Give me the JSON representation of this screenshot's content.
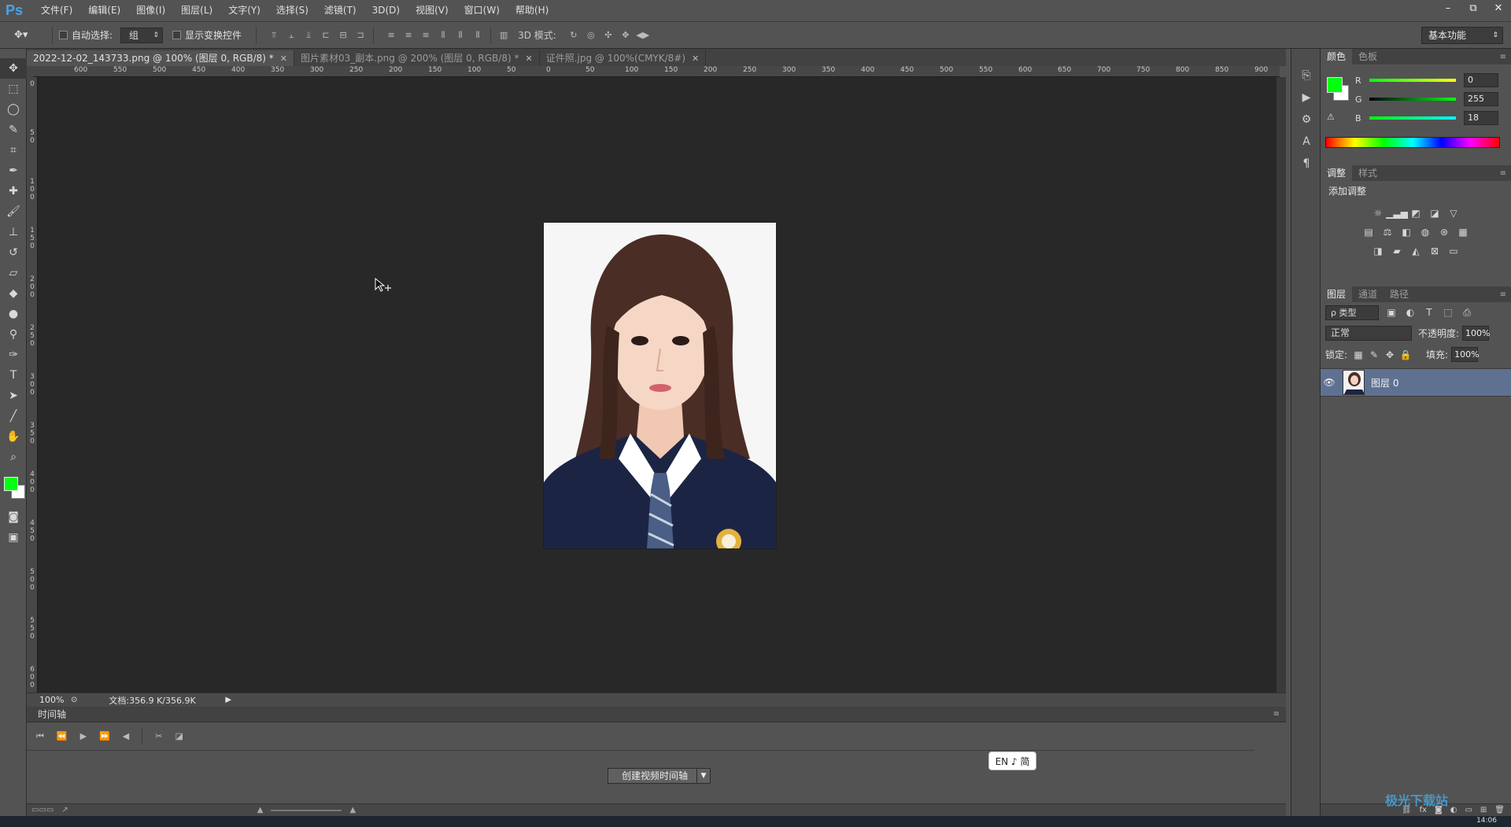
{
  "app": {
    "logo": "Ps"
  },
  "menu": [
    "文件(F)",
    "编辑(E)",
    "图像(I)",
    "图层(L)",
    "文字(Y)",
    "选择(S)",
    "滤镜(T)",
    "3D(D)",
    "视图(V)",
    "窗口(W)",
    "帮助(H)"
  ],
  "window_controls": {
    "minimize": "–",
    "restore": "⧉",
    "close": "✕"
  },
  "options": {
    "auto_select_label": "自动选择:",
    "auto_select_value": "组",
    "show_transform_label": "显示变换控件",
    "mode_3d_label": "3D 模式:",
    "workspace": "基本功能"
  },
  "tabs": [
    {
      "label": "2022-12-02_143733.png @ 100% (图层 0, RGB/8) *",
      "active": true
    },
    {
      "label": "图片素材03_副本.png @ 200% (图层 0, RGB/8) *",
      "active": false
    },
    {
      "label": "证件照.jpg @ 100%(CMYK/8#)",
      "active": false
    }
  ],
  "ruler_h_labels": [
    "600",
    "550",
    "500",
    "450",
    "400",
    "350",
    "300",
    "250",
    "200",
    "150",
    "100",
    "50",
    "0",
    "50",
    "100",
    "150",
    "200",
    "250",
    "300",
    "350",
    "400",
    "450",
    "500",
    "550",
    "600",
    "650",
    "700",
    "750",
    "800",
    "850",
    "900"
  ],
  "ruler_v_labels": [
    "0",
    "5 0",
    "1 0 0",
    "1 5 0",
    "2 0 0",
    "2 5 0",
    "3 0 0",
    "3 5 0",
    "4 0 0",
    "4 5 0",
    "5 0 0",
    "5 5 0",
    "6 0 0"
  ],
  "status": {
    "zoom": "100%",
    "doc_info": "文档:356.9 K/356.9K"
  },
  "timeline": {
    "title": "时间轴",
    "create_button": "创建视频时间轴"
  },
  "ime": "EN ♪ 简",
  "color_panel": {
    "tabs": [
      "颜色",
      "色板"
    ],
    "fg_color": "#00ff12",
    "bg_color": "#ffffff",
    "r_label": "R",
    "g_label": "G",
    "b_label": "B",
    "r": "0",
    "g": "255",
    "b": "18"
  },
  "adjust_panel": {
    "tabs": [
      "调整",
      "样式"
    ],
    "title": "添加调整"
  },
  "layers_panel": {
    "tabs": [
      "图层",
      "通道",
      "路径"
    ],
    "filter": "ρ 类型",
    "blend_mode": "正常",
    "opacity_label": "不透明度:",
    "opacity": "100%",
    "lock_label": "锁定:",
    "fill_label": "填充:",
    "fill": "100%",
    "layer_name": "图层 0"
  },
  "watermark": "极光下载站",
  "clock": "14:06"
}
